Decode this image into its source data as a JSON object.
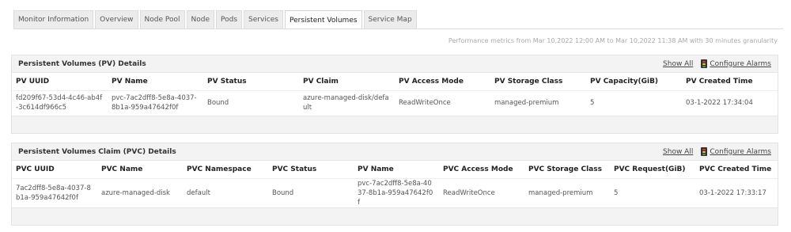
{
  "tabs": [
    {
      "label": "Monitor Information",
      "active": false
    },
    {
      "label": "Overview",
      "active": false
    },
    {
      "label": "Node Pool",
      "active": false
    },
    {
      "label": "Node",
      "active": false
    },
    {
      "label": "Pods",
      "active": false
    },
    {
      "label": "Services",
      "active": false
    },
    {
      "label": "Persistent Volumes",
      "active": true
    },
    {
      "label": "Service Map",
      "active": false
    }
  ],
  "performance_note": "Performance metrics from Mar 10,2022 12:00 AM to Mar 10,2022 11:38 AM with 30 minutes granularity",
  "pv_panel": {
    "title": "Persistent Volumes (PV) Details",
    "show_all": "Show All",
    "configure_alarms": "Configure Alarms",
    "columns": [
      "PV UUID",
      "PV Name",
      "PV Status",
      "PV Claim",
      "PV Access Mode",
      "PV Storage Class",
      "PV Capacity(GiB)",
      "PV Created Time"
    ],
    "rows": [
      [
        "fd209f67-53d4-4c46-ab4f-3c614df966c5",
        "pvc-7ac2dff8-5e8a-4037-8b1a-959a47642f0f",
        "Bound",
        "azure-managed-disk/default",
        "ReadWriteOnce",
        "managed-premium",
        "5",
        "03-1-2022 17:34:04"
      ]
    ]
  },
  "pvc_panel": {
    "title": "Persistent Volumes Claim (PVC) Details",
    "show_all": "Show All",
    "configure_alarms": "Configure Alarms",
    "columns": [
      "PVC UUID",
      "PVC Name",
      "PVC Namespace",
      "PVC Status",
      "PV Name",
      "PVC Access Mode",
      "PVC Storage Class",
      "PVC Request(GiB)",
      "PVC Created Time"
    ],
    "rows": [
      [
        "7ac2dff8-5e8a-4037-8b1a-959a47642f0f",
        "azure-managed-disk",
        "default",
        "Bound",
        "pvc-7ac2dff8-5e8a-4037-8b1a-959a47642f0f",
        "ReadWriteOnce",
        "managed-premium",
        "5",
        "03-1-2022 17:33:17"
      ]
    ]
  },
  "colors": {
    "alarm_red": "#e53935",
    "alarm_yellow": "#fbc02d",
    "alarm_green": "#43a047"
  }
}
